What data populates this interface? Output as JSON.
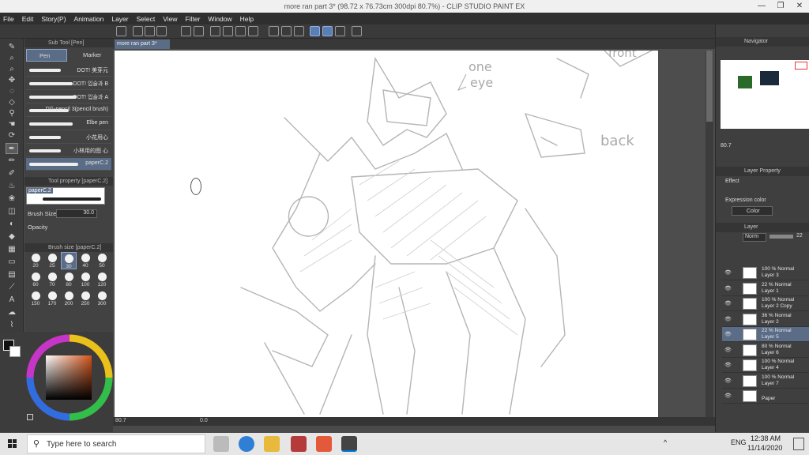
{
  "window": {
    "title": "more ran part 3* (98.72 x 76.73cm 300dpi 80.7%)  - CLIP STUDIO PAINT EX",
    "controls": [
      "—",
      "❐",
      "✕"
    ]
  },
  "menu": [
    "File",
    "Edit",
    "Story(P)",
    "Animation",
    "Layer",
    "Select",
    "View",
    "Filter",
    "Window",
    "Help"
  ],
  "subtool": {
    "header": "Sub Tool [Pen]",
    "tabs": [
      "Pen",
      "Marker"
    ],
    "brushes": [
      {
        "name": "DOT! 美芽元",
        "w": 40
      },
      {
        "name": "DOT! 입술과 B",
        "w": 55
      },
      {
        "name": "DOT! 입술과 A",
        "w": 60
      },
      {
        "name": "DG-pencil 3(pencil brush)",
        "w": 50
      },
      {
        "name": "Elbe pen",
        "w": 55
      },
      {
        "name": "小花用心",
        "w": 40
      },
      {
        "name": "小林用的图 心",
        "w": 40
      },
      {
        "name": "paperC.2",
        "w": 62
      }
    ]
  },
  "tool_property": {
    "header": "Tool property [paperC.2]",
    "preview_label": "paperC.2",
    "brush_size_label": "Brush Size",
    "brush_size_value": "30.0",
    "opacity_label": "Opacity"
  },
  "brush_size_panel": {
    "header": "Brush size [paperC.2]",
    "sizes": [
      "20",
      "25",
      "30",
      "40",
      "50",
      "60",
      "70",
      "80",
      "100",
      "120",
      "150",
      "170",
      "200",
      "250",
      "300"
    ],
    "selected": "30"
  },
  "canvas": {
    "tab_label": "more ran part 3*",
    "annotations": [
      "one",
      "eye",
      "front",
      "back"
    ],
    "zoom": "80.7",
    "angle": "0.0"
  },
  "navigator": {
    "header": "Navigator",
    "zoom": "80.7"
  },
  "layer_property": {
    "header": "Layer Property",
    "effect_label": "Effect",
    "expression_label": "Expression color",
    "expression_value": "Color"
  },
  "layers_panel": {
    "header": "Layer",
    "blend": "Norm",
    "opacity": "22",
    "layers": [
      {
        "pct": "100 %",
        "mode": "Normal",
        "name": "Layer 3",
        "active": false
      },
      {
        "pct": "22 %",
        "mode": "Normal",
        "name": "Layer 1",
        "active": false
      },
      {
        "pct": "100 %",
        "mode": "Normal",
        "name": "Layer 2 Copy",
        "active": false
      },
      {
        "pct": "36 %",
        "mode": "Normal",
        "name": "Layer 2",
        "active": false
      },
      {
        "pct": "22 %",
        "mode": "Normal",
        "name": "Layer 5",
        "active": true
      },
      {
        "pct": "80 %",
        "mode": "Normal",
        "name": "Layer 6",
        "active": false
      },
      {
        "pct": "100 %",
        "mode": "Normal",
        "name": "Layer 4",
        "active": false
      },
      {
        "pct": "100 %",
        "mode": "Normal",
        "name": "Layer 7",
        "active": false
      },
      {
        "pct": "",
        "mode": "",
        "name": "Paper",
        "active": false
      }
    ]
  },
  "taskbar": {
    "search_placeholder": "Type here to search",
    "language": "ENG",
    "time": "12:38 AM",
    "date": "11/14/2020"
  },
  "colors": {
    "accent": "#5a6c86",
    "canvas_bg": "#4d4d4d",
    "sketch": "#b5b5b5"
  }
}
